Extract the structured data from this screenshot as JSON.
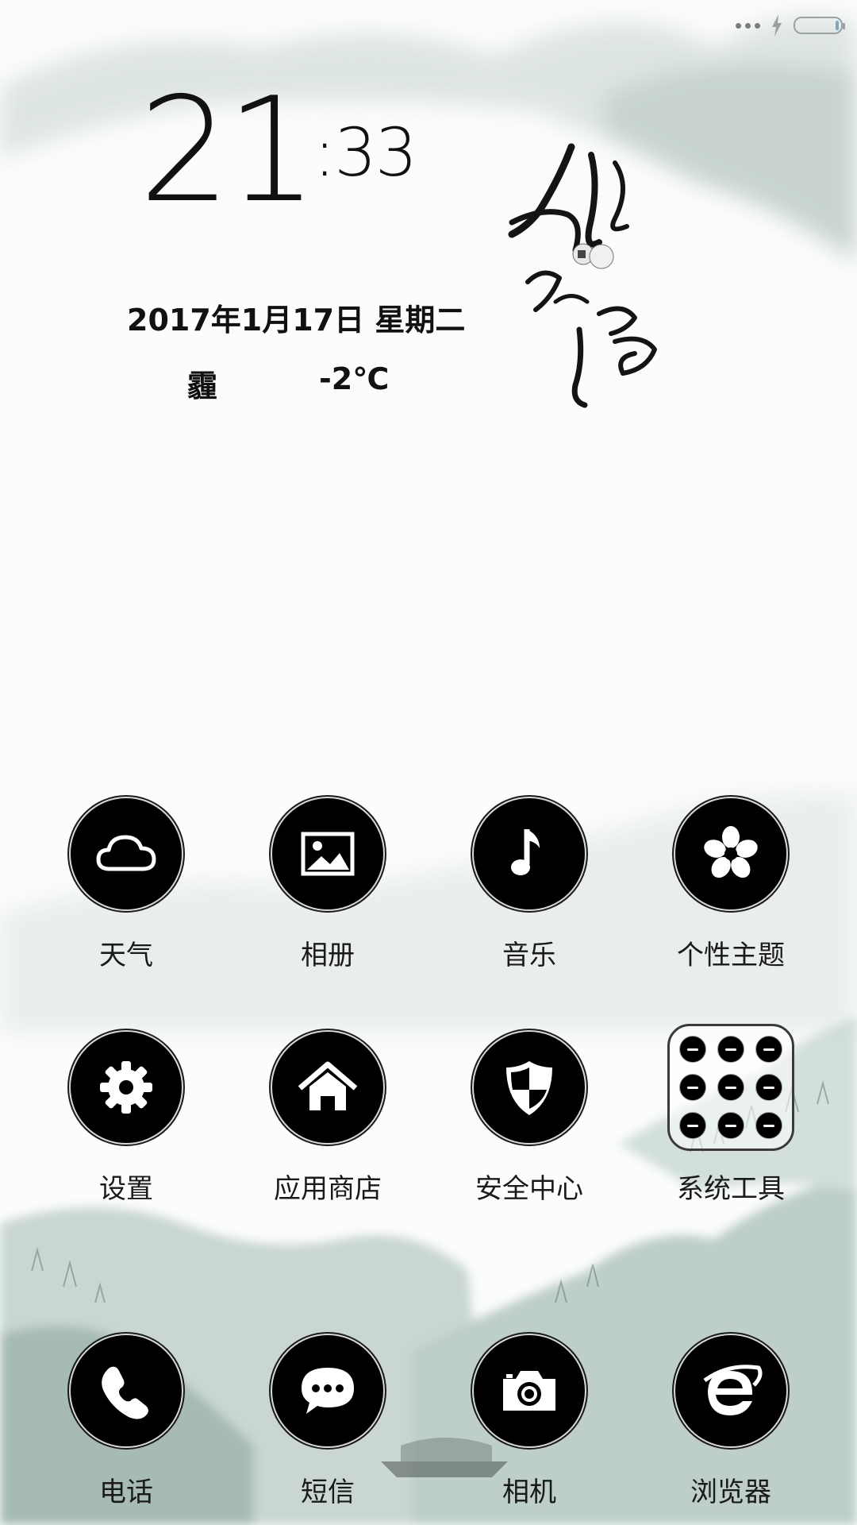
{
  "clock": {
    "hour": "21",
    "minute": ":33"
  },
  "date": "2017年1月17日 星期二",
  "weather": {
    "condition": "霾",
    "temperature": "-2℃"
  },
  "status_bar": {
    "battery": "battery-icon",
    "charging": "charging-bolt-icon"
  },
  "apps": [
    {
      "label": "天气",
      "icon": "cloud-icon"
    },
    {
      "label": "相册",
      "icon": "image-icon"
    },
    {
      "label": "音乐",
      "icon": "music-note-icon"
    },
    {
      "label": "个性主题",
      "icon": "flower-icon"
    },
    {
      "label": "设置",
      "icon": "gear-icon"
    },
    {
      "label": "应用商店",
      "icon": "house-icon"
    },
    {
      "label": "安全中心",
      "icon": "shield-icon"
    },
    {
      "label": "系统工具",
      "icon": "folder-icon"
    }
  ],
  "dock": [
    {
      "label": "电话",
      "icon": "phone-icon"
    },
    {
      "label": "短信",
      "icon": "chat-bubble-icon"
    },
    {
      "label": "相机",
      "icon": "camera-icon"
    },
    {
      "label": "浏览器",
      "icon": "browser-e-icon"
    }
  ],
  "colors": {
    "icon_bg": "#000000",
    "icon_fg": "#ffffff",
    "text": "#111111",
    "wash": "#bcd1c6"
  }
}
